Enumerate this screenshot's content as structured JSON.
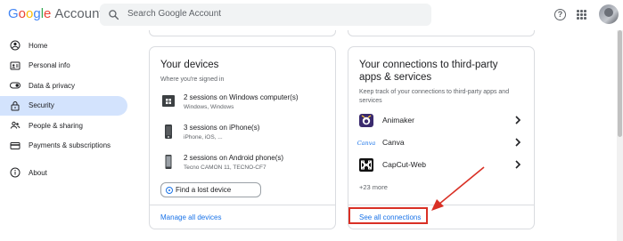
{
  "header": {
    "logo_google": [
      "G",
      "o",
      "o",
      "g",
      "l",
      "e"
    ],
    "logo_account": "Account",
    "search_placeholder": "Search Google Account"
  },
  "sidebar": {
    "items": [
      {
        "label": "Home",
        "icon": "person-circle-icon",
        "active": false
      },
      {
        "label": "Personal info",
        "icon": "id-card-icon",
        "active": false
      },
      {
        "label": "Data & privacy",
        "icon": "toggle-icon",
        "active": false
      },
      {
        "label": "Security",
        "icon": "lock-icon",
        "active": true
      },
      {
        "label": "People & sharing",
        "icon": "people-icon",
        "active": false
      },
      {
        "label": "Payments & subscriptions",
        "icon": "credit-card-icon",
        "active": false
      },
      {
        "label": "About",
        "icon": "info-icon",
        "active": false
      }
    ]
  },
  "devices_card": {
    "title": "Your devices",
    "subtitle": "Where you're signed in",
    "devices": [
      {
        "title": "2 sessions on Windows computer(s)",
        "detail": "Windows, Windows",
        "icon": "windows-computer-icon"
      },
      {
        "title": "3 sessions on iPhone(s)",
        "detail": "iPhone, iOS, ...",
        "icon": "iphone-icon"
      },
      {
        "title": "2 sessions on Android phone(s)",
        "detail": "Tecno CAMON 11, TECNO-CF7",
        "icon": "android-phone-icon"
      }
    ],
    "find_button": "Find a lost device",
    "manage_link": "Manage all devices"
  },
  "connections_card": {
    "title_line1": "Your connections to third-party",
    "title_line2": "apps & services",
    "subtitle_line1": "Keep track of your connections to third-party apps and",
    "subtitle_line2": "services",
    "apps": [
      {
        "name": "Animaker",
        "icon": "animaker-logo-icon"
      },
      {
        "name": "Canva",
        "icon": "canva-logo-icon",
        "logo_text": "Canva"
      },
      {
        "name": "CapCut-Web",
        "icon": "capcut-logo-icon"
      }
    ],
    "more": "+23 more",
    "see_all_link": "See all connections"
  },
  "colors": {
    "accent": "#1a73e8",
    "active_nav": "#d3e3fd",
    "annotation_red": "#d93025"
  }
}
